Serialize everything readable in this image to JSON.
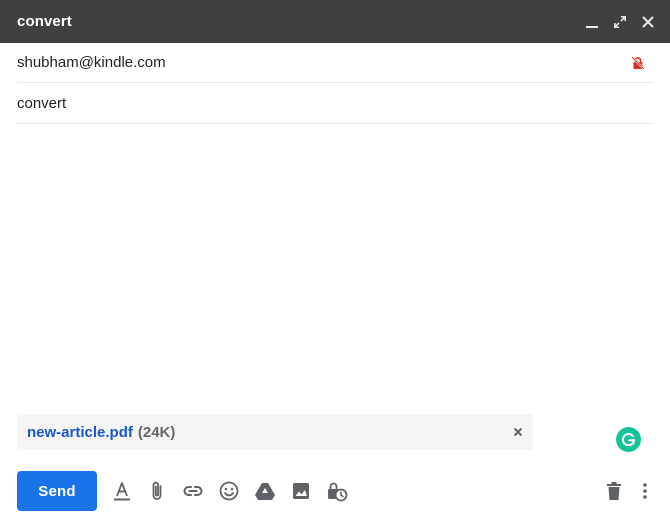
{
  "window": {
    "title": "convert",
    "controls": [
      "minimize-icon",
      "expand-icon",
      "close-icon"
    ]
  },
  "compose": {
    "to": "shubham@kindle.com",
    "to_icon": "restricted-lock-icon",
    "subject": "convert",
    "body": ""
  },
  "attachment": {
    "name": "new-article.pdf",
    "size": "(24K)",
    "remove_icon": "close-icon"
  },
  "toolbar": {
    "send_label": "Send",
    "icons": [
      "text-format-icon",
      "attach-icon",
      "link-icon",
      "emoji-icon",
      "drive-icon",
      "image-icon",
      "confidential-mode-icon",
      "delete-icon",
      "more-options-icon"
    ]
  },
  "extensions": {
    "grammarly_icon": "grammarly-icon"
  },
  "colors": {
    "titlebar": "#404040",
    "send_button": "#1a73e8",
    "attachment_link": "#1a57c9",
    "lock_icon": "#d93025",
    "grammarly": "#15c39a"
  }
}
